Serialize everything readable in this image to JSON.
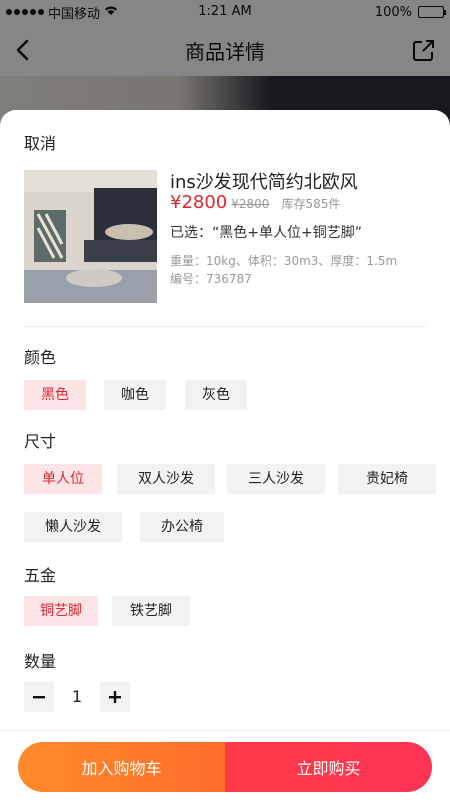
{
  "status_bar": {
    "carrier": "中国移动",
    "time": "1:21 AM",
    "battery": "100%",
    "battery_level": 1.0
  },
  "nav": {
    "title": "商品详情",
    "back_icon": "chevron-left-icon",
    "share_icon": "share-icon"
  },
  "sheet": {
    "cancel_label": "取消",
    "product": {
      "title": "ins沙发现代简约北欧风",
      "price": "¥2800",
      "original_price": "¥2800",
      "stock": "库存585件",
      "selected": "已选：“黑色+单人位+铜艺脚”",
      "specs_line1": "重量：10kg、体积：30m3、厚度：1.5m",
      "specs_line2": "编号：736787"
    },
    "color": {
      "label": "颜色",
      "options": [
        "黑色",
        "咖色",
        "灰色"
      ],
      "selected_index": 0
    },
    "size": {
      "label": "尺寸",
      "options": [
        "单人位",
        "双人沙发",
        "三人沙发",
        "贵妃椅",
        "懒人沙发",
        "办公椅"
      ],
      "selected_index": 0
    },
    "hardware": {
      "label": "五金",
      "options": [
        "铜艺脚",
        "铁艺脚"
      ],
      "selected_index": 0
    },
    "quantity": {
      "label": "数量",
      "value": "1",
      "minus": "−",
      "plus": "+"
    },
    "actions": {
      "add_to_cart": "加入购物车",
      "buy_now": "立即购买"
    }
  },
  "colors": {
    "accent": "#e0262f",
    "chip_active_bg": "#fde4e6",
    "cart_button": "#ff7a2a",
    "buy_button": "#ff3b4c"
  }
}
